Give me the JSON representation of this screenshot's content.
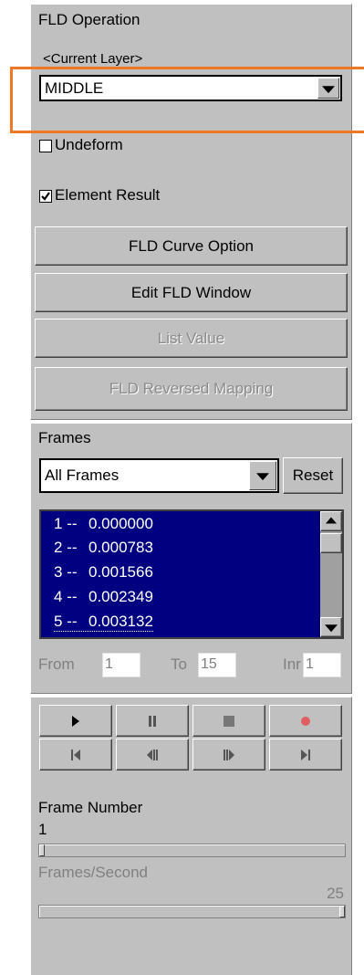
{
  "fld": {
    "title": "FLD Operation",
    "layer_label": "<Current Layer>",
    "layer_value": "MIDDLE",
    "undeform_label": "Undeform",
    "undeform_checked": false,
    "element_result_label": "Element Result",
    "element_result_checked": true,
    "curve_option_label": "FLD Curve Option",
    "edit_window_label": "Edit FLD Window",
    "list_value_label": "List Value",
    "reversed_mapping_label": "FLD Reversed Mapping"
  },
  "frames": {
    "title": "Frames",
    "selection_value": "All Frames",
    "reset_label": "Reset",
    "rows": [
      {
        "index": "1 --",
        "value": "0.000000"
      },
      {
        "index": "2 --",
        "value": "0.000783"
      },
      {
        "index": "3 --",
        "value": "0.001566"
      },
      {
        "index": "4 --",
        "value": "0.002349"
      },
      {
        "index": "5 --",
        "value": "0.003132"
      }
    ],
    "from_label": "From",
    "from_value": "1",
    "to_label": "To",
    "to_value": "15",
    "inr_label": "Inr",
    "inr_value": "1"
  },
  "playback": {
    "buttons": [
      "play-icon",
      "pause-icon",
      "stop-icon",
      "record-icon",
      "first-frame-icon",
      "step-back-icon",
      "step-forward-icon",
      "last-frame-icon"
    ],
    "frame_number_label": "Frame Number",
    "frame_number_value": "1",
    "fps_label": "Frames/Second",
    "fps_value": "25",
    "frame_slider_fraction": 0.0,
    "fps_slider_fraction": 1.0
  },
  "colors": {
    "panel": "#c0c0c0",
    "list_selection": "#000080",
    "highlight": "#f07824",
    "record": "#e06060"
  }
}
